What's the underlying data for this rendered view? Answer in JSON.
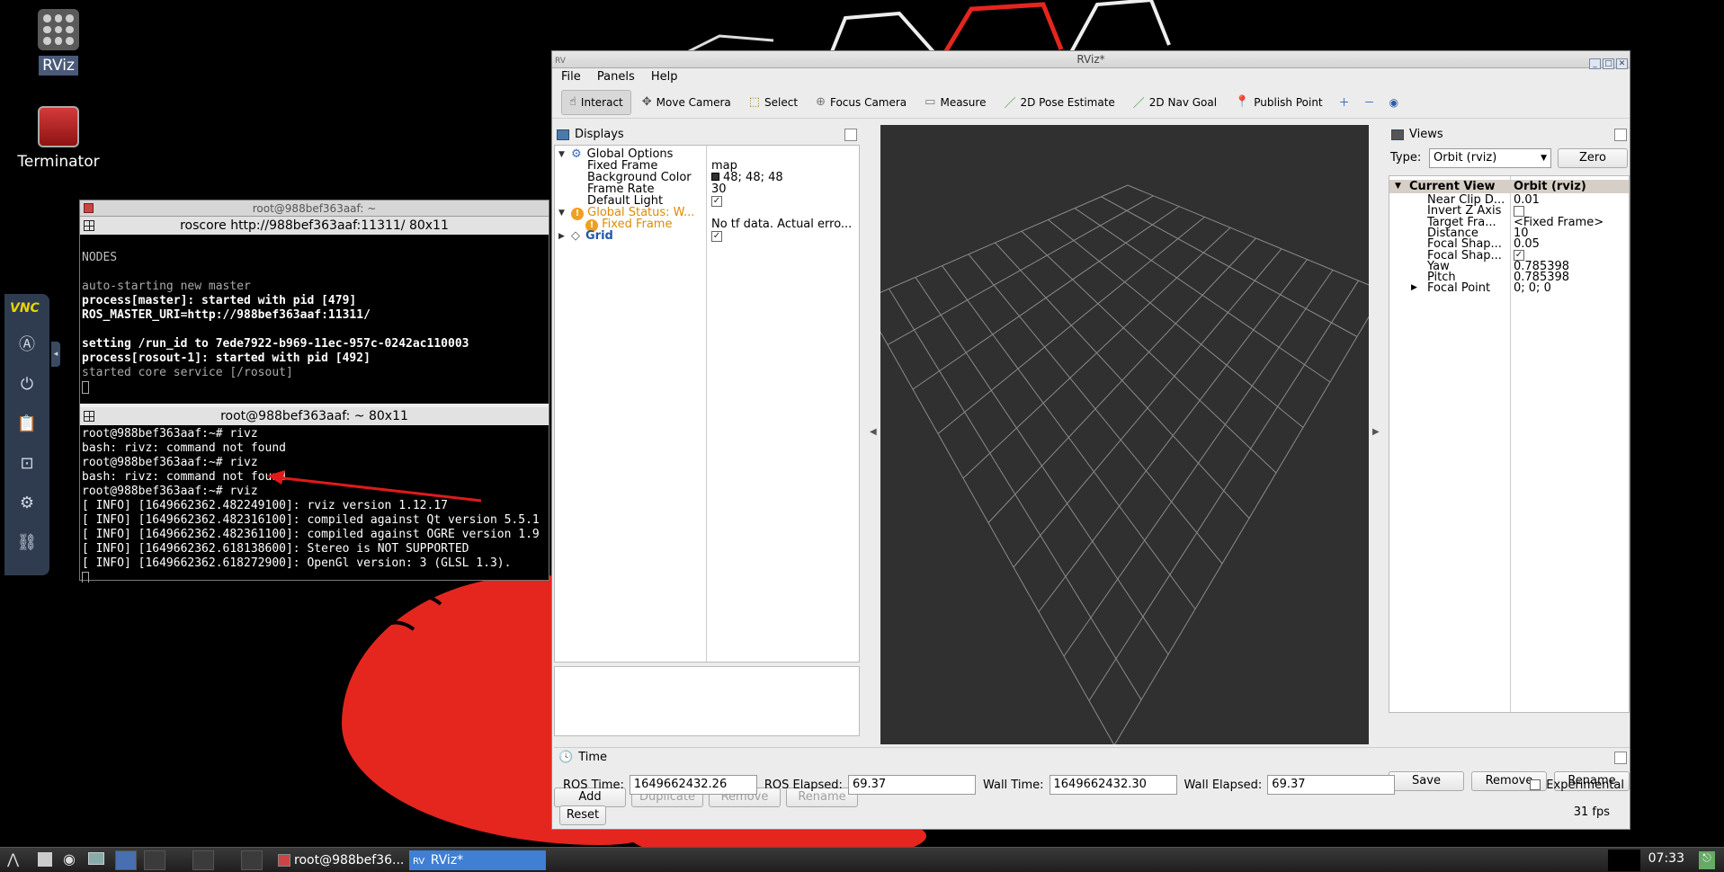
{
  "desktop": {
    "icons": [
      {
        "label": "RViz",
        "icon": "rviz-app-icon"
      },
      {
        "label": "Terminator",
        "icon": "terminal-app-icon"
      }
    ],
    "vnc": {
      "logo": "VNC"
    }
  },
  "terminator": {
    "window_title": "root@988bef363aaf: ~",
    "pane1_title": "roscore http://988bef363aaf:11311/ 80x11",
    "pane1_lines": [
      {
        "text": "",
        "style": "dim"
      },
      {
        "text": "NODES",
        "style": "gray"
      },
      {
        "text": "",
        "style": "dim"
      },
      {
        "text": "auto-starting new master",
        "style": "dim"
      },
      {
        "text": "process[master]: started with pid [479]",
        "style": "bold"
      },
      {
        "text": "ROS_MASTER_URI=http://988bef363aaf:11311/",
        "style": "bold"
      },
      {
        "text": "",
        "style": "dim"
      },
      {
        "text": "setting /run_id to 7ede7922-b969-11ec-957c-0242ac110003",
        "style": "bold"
      },
      {
        "text": "process[rosout-1]: started with pid [492]",
        "style": "bold"
      },
      {
        "text": "started core service [/rosout]",
        "style": "dim"
      }
    ],
    "pane2_title": "root@988bef363aaf: ~ 80x11",
    "pane2_lines": [
      "root@988bef363aaf:~# rivz",
      "bash: rivz: command not found",
      "root@988bef363aaf:~# rivz",
      "bash: rivz: command not found",
      "root@988bef363aaf:~# rviz",
      "[ INFO] [1649662362.482249100]: rviz version 1.12.17",
      "[ INFO] [1649662362.482316100]: compiled against Qt version 5.5.1",
      "[ INFO] [1649662362.482361100]: compiled against OGRE version 1.9",
      "[ INFO] [1649662362.618138600]: Stereo is NOT SUPPORTED",
      "[ INFO] [1649662362.618272900]: OpenGl version: 3 (GLSL 1.3)."
    ]
  },
  "rviz": {
    "title": "RViz*",
    "menu": [
      "File",
      "Panels",
      "Help"
    ],
    "tools": [
      {
        "label": "Interact",
        "icon": "interact-icon",
        "glyph": "☝",
        "active": true
      },
      {
        "label": "Move Camera",
        "icon": "move-camera-icon",
        "glyph": "✥",
        "active": false
      },
      {
        "label": "Select",
        "icon": "select-icon",
        "glyph": "⬚",
        "active": false
      },
      {
        "label": "Focus Camera",
        "icon": "focus-camera-icon",
        "glyph": "⊕",
        "active": false
      },
      {
        "label": "Measure",
        "icon": "measure-icon",
        "glyph": "▭",
        "active": false
      },
      {
        "label": "2D Pose Estimate",
        "icon": "pose-estimate-icon",
        "glyph": "／",
        "active": false
      },
      {
        "label": "2D Nav Goal",
        "icon": "nav-goal-icon",
        "glyph": "／",
        "active": false
      },
      {
        "label": "Publish Point",
        "icon": "publish-point-icon",
        "glyph": "📍",
        "active": false
      }
    ],
    "displays": {
      "title": "Displays",
      "rows": [
        {
          "key": "Global Options",
          "value": "",
          "indent": 1,
          "arrow": "▼",
          "type": "group"
        },
        {
          "key": "Fixed Frame",
          "value": "map",
          "indent": 2,
          "type": "prop"
        },
        {
          "key": "Background Color",
          "value": "48; 48; 48",
          "indent": 2,
          "type": "color"
        },
        {
          "key": "Frame Rate",
          "value": "30",
          "indent": 2,
          "type": "prop"
        },
        {
          "key": "Default Light",
          "value": "✓",
          "indent": 2,
          "type": "check"
        },
        {
          "key": "Global Status: W...",
          "value": "",
          "indent": 1,
          "arrow": "▼",
          "type": "warn-group"
        },
        {
          "key": "Fixed Frame",
          "value": "No tf data.  Actual erro...",
          "indent": 2,
          "type": "warn"
        },
        {
          "key": "Grid",
          "value": "✓",
          "indent": 1,
          "arrow": "▶",
          "type": "grid"
        }
      ],
      "buttons": [
        {
          "label": "Add",
          "enabled": true
        },
        {
          "label": "Duplicate",
          "enabled": false
        },
        {
          "label": "Remove",
          "enabled": false
        },
        {
          "label": "Rename",
          "enabled": false
        }
      ]
    },
    "views": {
      "title": "Views",
      "type_label": "Type:",
      "type_value": "Orbit (rviz)",
      "zero_label": "Zero",
      "header": {
        "key": "Current View",
        "value": "Orbit (rviz)"
      },
      "rows": [
        {
          "key": "Near Clip D...",
          "value": "0.01"
        },
        {
          "key": "Invert Z Axis",
          "value": "",
          "check": true,
          "checked": false
        },
        {
          "key": "Target Fra...",
          "value": "<Fixed Frame>"
        },
        {
          "key": "Distance",
          "value": "10"
        },
        {
          "key": "Focal Shap...",
          "value": "0.05"
        },
        {
          "key": "Focal Shap...",
          "value": "✓",
          "check": true,
          "checked": true
        },
        {
          "key": "Yaw",
          "value": "0.785398"
        },
        {
          "key": "Pitch",
          "value": "0.785398"
        },
        {
          "key": "Focal Point",
          "value": "0; 0; 0",
          "arrow": "▶"
        }
      ],
      "buttons": [
        "Save",
        "Remove",
        "Rename"
      ]
    },
    "time": {
      "title": "Time",
      "ros_time_label": "ROS Time:",
      "ros_time": "1649662432.26",
      "ros_elapsed_label": "ROS Elapsed:",
      "ros_elapsed": "69.37",
      "wall_time_label": "Wall Time:",
      "wall_time": "1649662432.30",
      "wall_elapsed_label": "Wall Elapsed:",
      "wall_elapsed": "69.37",
      "experimental_label": "Experimental",
      "reset_label": "Reset",
      "fps": "31 fps"
    }
  },
  "taskbar": {
    "items": [
      {
        "label": "root@988bef36...",
        "icon": "terminator-task-icon"
      },
      {
        "label": "RViz*",
        "icon": "rviz-task-icon",
        "prefix": "RV"
      }
    ],
    "clock": "07:33"
  }
}
